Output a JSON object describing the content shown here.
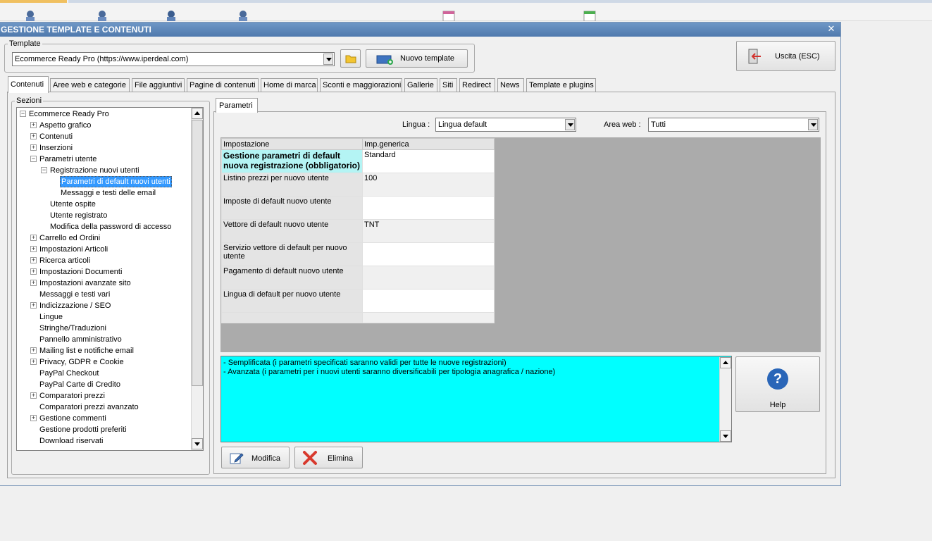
{
  "window": {
    "title": "GESTIONE TEMPLATE E CONTENUTI",
    "close_glyph": "✕"
  },
  "template_group": {
    "legend": "Template",
    "selected": "Ecommerce Ready Pro (https://www.iperdeal.com)",
    "new_button": "Nuovo template"
  },
  "exit_button": "Uscita (ESC)",
  "tabs": [
    {
      "label": "Contenuti",
      "active": true
    },
    {
      "label": "Aree web e categorie"
    },
    {
      "label": "File aggiuntivi"
    },
    {
      "label": "Pagine di contenuti"
    },
    {
      "label": "Home di marca"
    },
    {
      "label": "Sconti e maggiorazioni"
    },
    {
      "label": "Gallerie"
    },
    {
      "label": "Siti"
    },
    {
      "label": "Redirect"
    },
    {
      "label": "News"
    },
    {
      "label": "Template e plugins"
    }
  ],
  "sections": {
    "legend": "Sezioni",
    "tree": [
      {
        "label": "Ecommerce Ready Pro",
        "level": 0,
        "exp": "−"
      },
      {
        "label": "Aspetto grafico",
        "level": 1,
        "exp": "+"
      },
      {
        "label": "Contenuti",
        "level": 1,
        "exp": "+"
      },
      {
        "label": "Inserzioni",
        "level": 1,
        "exp": "+"
      },
      {
        "label": "Parametri utente",
        "level": 1,
        "exp": "−"
      },
      {
        "label": "Registrazione nuovi utenti",
        "level": 2,
        "exp": "−"
      },
      {
        "label": "Parametri di default nuovi utenti",
        "level": 3,
        "selected": true
      },
      {
        "label": "Messaggi e testi delle email",
        "level": 3
      },
      {
        "label": "Utente ospite",
        "level": 2
      },
      {
        "label": "Utente registrato",
        "level": 2
      },
      {
        "label": "Modifica della password di accesso",
        "level": 2
      },
      {
        "label": "Carrello ed Ordini",
        "level": 1,
        "exp": "+"
      },
      {
        "label": "Impostazioni Articoli",
        "level": 1,
        "exp": "+"
      },
      {
        "label": "Ricerca articoli",
        "level": 1,
        "exp": "+"
      },
      {
        "label": "Impostazioni Documenti",
        "level": 1,
        "exp": "+"
      },
      {
        "label": "Impostazioni avanzate sito",
        "level": 1,
        "exp": "+"
      },
      {
        "label": "Messaggi e testi vari",
        "level": 1
      },
      {
        "label": "Indicizzazione / SEO",
        "level": 1,
        "exp": "+"
      },
      {
        "label": "Lingue",
        "level": 1
      },
      {
        "label": "Stringhe/Traduzioni",
        "level": 1
      },
      {
        "label": "Pannello amministrativo",
        "level": 1
      },
      {
        "label": "Mailing list e notifiche email",
        "level": 1,
        "exp": "+"
      },
      {
        "label": "Privacy, GDPR e Cookie",
        "level": 1,
        "exp": "+"
      },
      {
        "label": "PayPal Checkout",
        "level": 1
      },
      {
        "label": "PayPal Carte di Credito",
        "level": 1
      },
      {
        "label": "Comparatori prezzi",
        "level": 1,
        "exp": "+"
      },
      {
        "label": "Comparatori prezzi avanzato",
        "level": 1
      },
      {
        "label": "Gestione commenti",
        "level": 1,
        "exp": "+"
      },
      {
        "label": "Gestione prodotti preferiti",
        "level": 1
      },
      {
        "label": "Download riservati",
        "level": 1
      }
    ]
  },
  "params_tab": "Parametri",
  "filters": {
    "lingua_label": "Lingua :",
    "lingua_value": "Lingua default",
    "area_label": "Area web :",
    "area_value": "Tutti"
  },
  "grid": {
    "headers": [
      "Impostazione",
      "Imp.generica"
    ],
    "rows": [
      {
        "setting": "Gestione parametri di default nuova registrazione (obbligatorio)",
        "value": "Standard",
        "current": true
      },
      {
        "setting": "Listino prezzi per nuovo utente",
        "value": "100"
      },
      {
        "setting": "Imposte di default nuovo utente",
        "value": ""
      },
      {
        "setting": "Vettore di default nuovo utente",
        "value": "TNT"
      },
      {
        "setting": "Servizio vettore di default per nuovo utente",
        "value": ""
      },
      {
        "setting": "Pagamento di default nuovo utente",
        "value": ""
      },
      {
        "setting": "Lingua di default per nuovo utente",
        "value": ""
      }
    ]
  },
  "description": {
    "line1": "- Semplificata (i parametri specificati saranno validi per tutte le nuove registrazioni)",
    "line2": "- Avanzata (i parametri per i nuovi utenti saranno diversificabili per tipologia anagrafica / nazione)"
  },
  "help_button": "Help",
  "help_glyph": "?",
  "modify_button": "Modifica",
  "delete_button": "Elimina",
  "colors": {
    "title_bar": "#5a84b8",
    "description_bg": "#00ffff",
    "grid_empty": "#ababab",
    "selected_row": "#b4f4f4"
  }
}
